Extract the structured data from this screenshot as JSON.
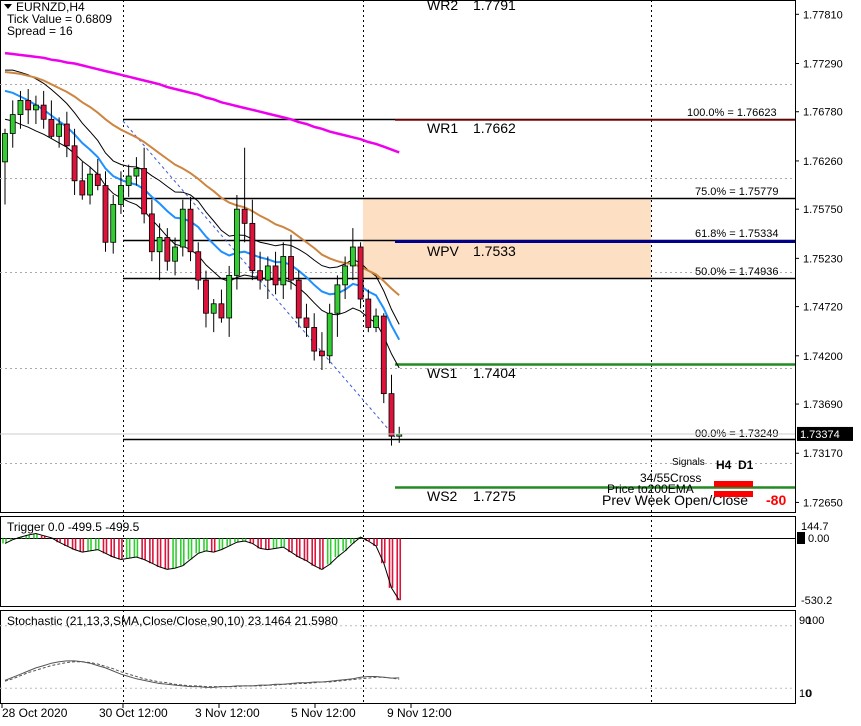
{
  "header": {
    "symbol": "EURNZD,H4",
    "tick_value": "Tick Value = 0.6809",
    "spread": "Spread = 16"
  },
  "price_axis": {
    "labels": [
      "1.77810",
      "1.77290",
      "1.76780",
      "1.76260",
      "1.75750",
      "1.75230",
      "1.74720",
      "1.74200",
      "1.73690",
      "1.73170",
      "1.72650"
    ],
    "current_price": "1.73374",
    "current_price_bg": "#000000"
  },
  "time_axis": {
    "labels": [
      "28 Oct 2020",
      "30 Oct 12:00",
      "3 Nov 12:00",
      "5 Nov 12:00",
      "9 Nov 12:00"
    ]
  },
  "pivots": [
    {
      "name": "WR2",
      "value": "1.7791",
      "color": "#000000"
    },
    {
      "name": "WR1",
      "value": "1.7662",
      "color": "#000000"
    },
    {
      "name": "WPV",
      "value": "1.7533",
      "color": "#00008b"
    },
    {
      "name": "WS1",
      "value": "1.7404",
      "color": "#228b22"
    },
    {
      "name": "WS2",
      "value": "1.7275",
      "color": "#228b22"
    }
  ],
  "fibonacci": [
    {
      "label": "100.0% = 1.76623"
    },
    {
      "label": "75.0% = 1.75779"
    },
    {
      "label": "61.8% = 1.75334"
    },
    {
      "label": "50.0% = 1.74936"
    },
    {
      "label": "00.0% = 1.73249"
    }
  ],
  "signals": {
    "title": "Signals",
    "col_h4": "H4",
    "col_d1": "D1",
    "row1": "34/55Cross",
    "row2": "Price to200EMA",
    "row3": "Prev Week Open/Close",
    "row3_value": "-80",
    "signal_color": "#ff0000"
  },
  "trigger_panel": {
    "title": "Trigger 0.0 -499.5 -499.5",
    "axis_top": "144.7",
    "axis_zero": "0.00",
    "axis_bottom": "-530.2"
  },
  "stochastic_panel": {
    "title": "Stochastic (21,13,3,SMA,Close/Close,90,10) 23.1464 21.5980",
    "axis_top": "100",
    "axis_mid": "90",
    "axis_low": "10",
    "axis_bottom": "0"
  },
  "colors": {
    "ema_fast": "#1e90ff",
    "ema_mid": "#cd853f",
    "ema_slow": "#ee00ee",
    "bull_candle": "#32cd32",
    "bear_candle": "#dc143c",
    "zone_fill": "#fde0c4"
  },
  "chart_data": {
    "type": "candlestick",
    "symbol": "EURNZD",
    "timeframe": "H4",
    "ylim": [
      1.7257,
      1.7794
    ],
    "candles": [
      {
        "o": 1.7625,
        "h": 1.766,
        "l": 1.758,
        "c": 1.7655
      },
      {
        "o": 1.7655,
        "h": 1.769,
        "l": 1.764,
        "c": 1.7675
      },
      {
        "o": 1.7675,
        "h": 1.77,
        "l": 1.766,
        "c": 1.769
      },
      {
        "o": 1.769,
        "h": 1.7702,
        "l": 1.7665,
        "c": 1.768
      },
      {
        "o": 1.768,
        "h": 1.7695,
        "l": 1.7665,
        "c": 1.7685
      },
      {
        "o": 1.7685,
        "h": 1.77,
        "l": 1.766,
        "c": 1.767
      },
      {
        "o": 1.767,
        "h": 1.769,
        "l": 1.765,
        "c": 1.7652
      },
      {
        "o": 1.7652,
        "h": 1.7672,
        "l": 1.764,
        "c": 1.7665
      },
      {
        "o": 1.7665,
        "h": 1.7678,
        "l": 1.763,
        "c": 1.7642
      },
      {
        "o": 1.7642,
        "h": 1.766,
        "l": 1.759,
        "c": 1.7605
      },
      {
        "o": 1.7605,
        "h": 1.7625,
        "l": 1.7585,
        "c": 1.759
      },
      {
        "o": 1.759,
        "h": 1.762,
        "l": 1.758,
        "c": 1.7612
      },
      {
        "o": 1.7612,
        "h": 1.7628,
        "l": 1.7595,
        "c": 1.76
      },
      {
        "o": 1.76,
        "h": 1.7615,
        "l": 1.753,
        "c": 1.754
      },
      {
        "o": 1.754,
        "h": 1.759,
        "l": 1.7528,
        "c": 1.758
      },
      {
        "o": 1.758,
        "h": 1.7615,
        "l": 1.757,
        "c": 1.76
      },
      {
        "o": 1.76,
        "h": 1.7622,
        "l": 1.7588,
        "c": 1.761
      },
      {
        "o": 1.761,
        "h": 1.763,
        "l": 1.76,
        "c": 1.7618
      },
      {
        "o": 1.7618,
        "h": 1.764,
        "l": 1.756,
        "c": 1.757
      },
      {
        "o": 1.757,
        "h": 1.7585,
        "l": 1.752,
        "c": 1.753
      },
      {
        "o": 1.753,
        "h": 1.756,
        "l": 1.75,
        "c": 1.7545
      },
      {
        "o": 1.7545,
        "h": 1.7555,
        "l": 1.751,
        "c": 1.752
      },
      {
        "o": 1.752,
        "h": 1.7545,
        "l": 1.7505,
        "c": 1.7535
      },
      {
        "o": 1.7535,
        "h": 1.7585,
        "l": 1.7525,
        "c": 1.7575
      },
      {
        "o": 1.7575,
        "h": 1.7588,
        "l": 1.752,
        "c": 1.753
      },
      {
        "o": 1.753,
        "h": 1.754,
        "l": 1.749,
        "c": 1.75
      },
      {
        "o": 1.75,
        "h": 1.751,
        "l": 1.745,
        "c": 1.7465
      },
      {
        "o": 1.7465,
        "h": 1.748,
        "l": 1.7445,
        "c": 1.7475
      },
      {
        "o": 1.7475,
        "h": 1.749,
        "l": 1.7455,
        "c": 1.746
      },
      {
        "o": 1.746,
        "h": 1.7515,
        "l": 1.744,
        "c": 1.7505
      },
      {
        "o": 1.7505,
        "h": 1.759,
        "l": 1.749,
        "c": 1.7575
      },
      {
        "o": 1.7575,
        "h": 1.764,
        "l": 1.754,
        "c": 1.756
      },
      {
        "o": 1.756,
        "h": 1.7585,
        "l": 1.75,
        "c": 1.751
      },
      {
        "o": 1.751,
        "h": 1.753,
        "l": 1.749,
        "c": 1.75
      },
      {
        "o": 1.75,
        "h": 1.7525,
        "l": 1.748,
        "c": 1.7515
      },
      {
        "o": 1.7515,
        "h": 1.753,
        "l": 1.7485,
        "c": 1.7495
      },
      {
        "o": 1.7495,
        "h": 1.754,
        "l": 1.748,
        "c": 1.7525
      },
      {
        "o": 1.7525,
        "h": 1.7548,
        "l": 1.749,
        "c": 1.75
      },
      {
        "o": 1.75,
        "h": 1.751,
        "l": 1.745,
        "c": 1.746
      },
      {
        "o": 1.746,
        "h": 1.7475,
        "l": 1.744,
        "c": 1.745
      },
      {
        "o": 1.745,
        "h": 1.7465,
        "l": 1.7415,
        "c": 1.7425
      },
      {
        "o": 1.7425,
        "h": 1.7445,
        "l": 1.7405,
        "c": 1.742
      },
      {
        "o": 1.742,
        "h": 1.7475,
        "l": 1.7412,
        "c": 1.7465
      },
      {
        "o": 1.7465,
        "h": 1.7505,
        "l": 1.744,
        "c": 1.7495
      },
      {
        "o": 1.7495,
        "h": 1.7525,
        "l": 1.748,
        "c": 1.7515
      },
      {
        "o": 1.7515,
        "h": 1.7555,
        "l": 1.75,
        "c": 1.7535
      },
      {
        "o": 1.7535,
        "h": 1.754,
        "l": 1.747,
        "c": 1.748
      },
      {
        "o": 1.748,
        "h": 1.749,
        "l": 1.7445,
        "c": 1.745
      },
      {
        "o": 1.745,
        "h": 1.747,
        "l": 1.7445,
        "c": 1.7462
      },
      {
        "o": 1.7462,
        "h": 1.7465,
        "l": 1.737,
        "c": 1.738
      },
      {
        "o": 1.738,
        "h": 1.74,
        "l": 1.7325,
        "c": 1.7335
      },
      {
        "o": 1.7335,
        "h": 1.7345,
        "l": 1.7328,
        "c": 1.7337
      }
    ],
    "ema_fast": [
      1.77,
      1.7698,
      1.7694,
      1.769,
      1.7685,
      1.768,
      1.7674,
      1.7668,
      1.7662,
      1.7654,
      1.7645,
      1.7638,
      1.763,
      1.7618,
      1.761,
      1.7606,
      1.7603,
      1.7601,
      1.7596,
      1.7588,
      1.7581,
      1.7573,
      1.7566,
      1.7565,
      1.7562,
      1.7556,
      1.7546,
      1.7538,
      1.753,
      1.7526,
      1.7529,
      1.753,
      1.7527,
      1.7524,
      1.7522,
      1.7519,
      1.7519,
      1.7516,
      1.751,
      1.7503,
      1.7495,
      1.7488,
      1.7485,
      1.7486,
      1.749,
      1.7496,
      1.7494,
      1.7488,
      1.7484,
      1.747,
      1.7452,
      1.7437
    ],
    "ema_mid": [
      1.772,
      1.7719,
      1.7718,
      1.7716,
      1.7714,
      1.7711,
      1.7707,
      1.7703,
      1.7699,
      1.7694,
      1.7688,
      1.7683,
      1.7677,
      1.767,
      1.7664,
      1.7659,
      1.7655,
      1.7651,
      1.7646,
      1.764,
      1.7634,
      1.7628,
      1.7622,
      1.7618,
      1.7613,
      1.7607,
      1.76,
      1.7594,
      1.7587,
      1.7582,
      1.7579,
      1.7577,
      1.7573,
      1.7568,
      1.7564,
      1.7559,
      1.7556,
      1.7552,
      1.7546,
      1.754,
      1.7534,
      1.7527,
      1.7523,
      1.752,
      1.7518,
      1.7517,
      1.7514,
      1.751,
      1.7506,
      1.7499,
      1.7491,
      1.7484
    ],
    "ema_slow": [
      1.774,
      1.7739,
      1.7738,
      1.7737,
      1.7736,
      1.7735,
      1.7733,
      1.7732,
      1.773,
      1.7729,
      1.7727,
      1.7725,
      1.7723,
      1.7721,
      1.7719,
      1.7717,
      1.7715,
      1.7713,
      1.7711,
      1.7709,
      1.7707,
      1.7704,
      1.7702,
      1.77,
      1.7698,
      1.7696,
      1.7693,
      1.7691,
      1.7688,
      1.7686,
      1.7684,
      1.7682,
      1.768,
      1.7678,
      1.7676,
      1.7674,
      1.7672,
      1.767,
      1.7667,
      1.7665,
      1.7662,
      1.766,
      1.7657,
      1.7655,
      1.7653,
      1.7651,
      1.7649,
      1.7646,
      1.7644,
      1.7641,
      1.7638,
      1.7635
    ],
    "trigger": [
      -40,
      -10,
      10,
      25,
      35,
      20,
      5,
      -30,
      -60,
      -90,
      -110,
      -100,
      -90,
      -120,
      -150,
      -170,
      -160,
      -150,
      -170,
      -200,
      -230,
      -250,
      -240,
      -220,
      -170,
      -120,
      -100,
      -110,
      -90,
      -60,
      -30,
      -20,
      -40,
      -80,
      -90,
      -80,
      -70,
      -110,
      -150,
      -180,
      -220,
      -250,
      -210,
      -150,
      -100,
      -40,
      10,
      -20,
      -60,
      -200,
      -400,
      -499.5
    ],
    "stochastic_main": [
      20,
      24,
      28,
      32,
      36,
      39,
      42,
      44,
      45,
      45,
      44,
      42,
      39,
      36,
      32,
      28,
      25,
      22,
      20,
      18,
      16,
      15,
      14,
      13,
      12,
      12,
      11,
      11,
      12,
      12,
      13,
      13,
      13,
      14,
      14,
      15,
      15,
      16,
      17,
      17,
      18,
      18,
      19,
      20,
      21,
      22,
      24,
      25,
      25,
      24,
      23,
      23.1464
    ],
    "stochastic_signal": [
      19,
      22,
      26,
      30,
      33,
      36,
      39,
      41,
      43,
      44,
      44,
      43,
      41,
      38,
      35,
      31,
      28,
      25,
      22,
      20,
      18,
      17,
      15,
      14,
      13,
      13,
      12,
      12,
      12,
      12,
      12,
      13,
      13,
      13,
      14,
      14,
      15,
      15,
      16,
      16,
      17,
      18,
      18,
      19,
      20,
      21,
      22,
      23,
      24,
      24,
      23,
      21.598
    ]
  }
}
